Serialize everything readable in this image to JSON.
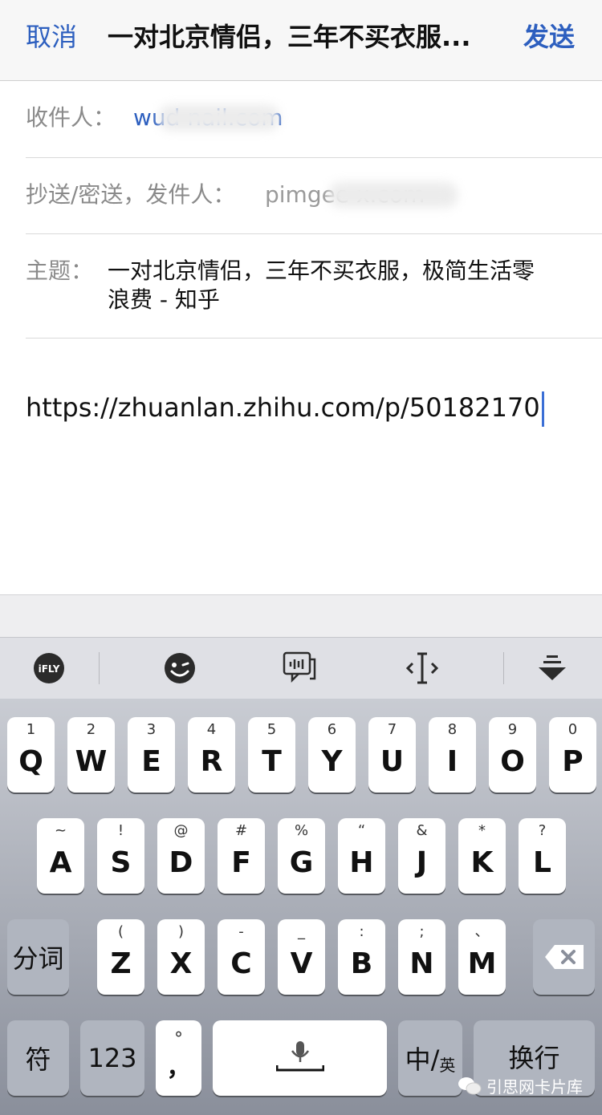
{
  "header": {
    "cancel_label": "取消",
    "title": "一对北京情侣，三年不买衣服...",
    "send_label": "发送"
  },
  "fields": {
    "to_label": "收件人：",
    "to_value": "wud              nail.com",
    "cc_label": "抄送/密送，发件人：",
    "cc_value": "pimgee              x.com",
    "subject_label": "主题：",
    "subject_value": "一对北京情侣，三年不买衣服，极简生活零浪费 - 知乎"
  },
  "body": {
    "text": "https://zhuanlan.zhihu.com/p/50182170"
  },
  "toolbar": {
    "items": [
      "iFLY",
      "emoji",
      "voice-message",
      "cursor",
      "collapse"
    ]
  },
  "keyboard": {
    "row1": [
      {
        "main": "Q",
        "sub": "1"
      },
      {
        "main": "W",
        "sub": "2"
      },
      {
        "main": "E",
        "sub": "3"
      },
      {
        "main": "R",
        "sub": "4"
      },
      {
        "main": "T",
        "sub": "5"
      },
      {
        "main": "Y",
        "sub": "6"
      },
      {
        "main": "U",
        "sub": "7"
      },
      {
        "main": "I",
        "sub": "8"
      },
      {
        "main": "O",
        "sub": "9"
      },
      {
        "main": "P",
        "sub": "0"
      }
    ],
    "row2": [
      {
        "main": "A",
        "sub": "~"
      },
      {
        "main": "S",
        "sub": "!"
      },
      {
        "main": "D",
        "sub": "@"
      },
      {
        "main": "F",
        "sub": "#"
      },
      {
        "main": "G",
        "sub": "%"
      },
      {
        "main": "H",
        "sub": "“"
      },
      {
        "main": "J",
        "sub": "&"
      },
      {
        "main": "K",
        "sub": "*"
      },
      {
        "main": "L",
        "sub": "?"
      }
    ],
    "row3": [
      {
        "main": "Z",
        "sub": "("
      },
      {
        "main": "X",
        "sub": ")"
      },
      {
        "main": "C",
        "sub": "-"
      },
      {
        "main": "V",
        "sub": "_"
      },
      {
        "main": "B",
        "sub": ":"
      },
      {
        "main": "N",
        "sub": ";"
      },
      {
        "main": "M",
        "sub": "、"
      }
    ],
    "fenci_label": "分词",
    "fu_label": "符",
    "num_label": "123",
    "punct_top": "°",
    "punct_bottom": "，",
    "lang_main": "中/",
    "lang_sub": "英",
    "return_label": "换行"
  },
  "watermark": "引思网卡片库",
  "colors": {
    "accent": "#2d5fbf",
    "caret": "#3b6fd6"
  }
}
